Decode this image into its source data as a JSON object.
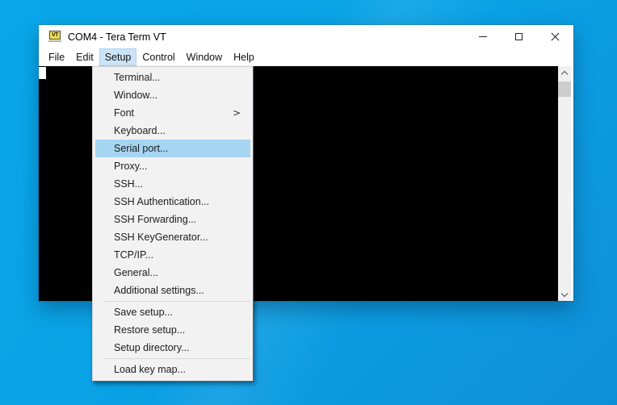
{
  "window": {
    "title": "COM4 - Tera Term VT",
    "icon_text": "VT"
  },
  "menubar": {
    "items": [
      "File",
      "Edit",
      "Setup",
      "Control",
      "Window",
      "Help"
    ],
    "active_item": "Setup"
  },
  "setup_menu": {
    "items": [
      "Terminal...",
      "Window...",
      "Font",
      "Keyboard...",
      "Serial port...",
      "Proxy...",
      "SSH...",
      "SSH Authentication...",
      "SSH Forwarding...",
      "SSH KeyGenerator...",
      "TCP/IP...",
      "General...",
      "Additional settings...",
      "Save setup...",
      "Restore setup...",
      "Setup directory...",
      "Load key map..."
    ],
    "highlighted_item": "Serial port...",
    "submenu_item": "Font"
  },
  "icons": {
    "submenu_arrow": ">",
    "minimize": "horizontal-line",
    "maximize": "square-outline",
    "close": "x-cross",
    "scroll_up": "chevron-up",
    "scroll_down": "chevron-down"
  },
  "colors": {
    "desktop_blue": "#0aa2e6",
    "menu_highlight": "#a6d5f2",
    "menubar_highlight": "#cce4f7",
    "terminal_bg": "#000000",
    "window_bg": "#ffffff"
  }
}
